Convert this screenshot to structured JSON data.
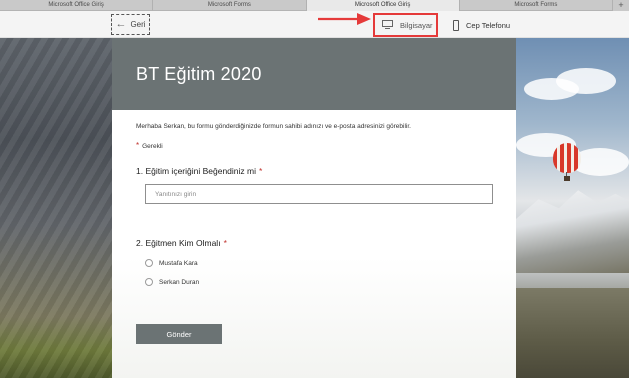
{
  "browser": {
    "tabs": [
      {
        "label": "Microsoft Office Giriş",
        "active": false
      },
      {
        "label": "Microsoft Forms",
        "active": false
      },
      {
        "label": "Microsoft Office Giriş",
        "active": true
      },
      {
        "label": "Microsoft Forms",
        "active": false
      }
    ],
    "new_tab_symbol": "+"
  },
  "toolbar": {
    "back_label": "Geri",
    "desktop_label": "Bilgisayar",
    "mobile_label": "Cep Telefonu",
    "icons": {
      "back": "arrow-left-icon",
      "desktop": "monitor-icon",
      "mobile": "phone-icon"
    }
  },
  "annotation": {
    "color": "#e53a3a",
    "target": "desktop-preview-button"
  },
  "form": {
    "title": "BT Eğitim 2020",
    "notice": "Merhaba Serkan, bu formu gönderdiğinizde formun sahibi adınızı ve e-posta adresinizi görebilir.",
    "required_marker": "*",
    "required_label": "Gerekli",
    "questions": [
      {
        "title": "1. Eğitim içeriğini Beğendiniz mi",
        "required": true,
        "type": "text",
        "placeholder": "Yanıtınızı girin"
      },
      {
        "title": "2. Eğitmen Kim Olmalı",
        "required": true,
        "type": "choice",
        "options": [
          "Mustafa Kara",
          "Serkan Duran"
        ]
      }
    ],
    "submit_label": "Gönder",
    "colors": {
      "header": "#6b7374",
      "accent_required": "#c0312c",
      "button": "#6b7374"
    }
  }
}
